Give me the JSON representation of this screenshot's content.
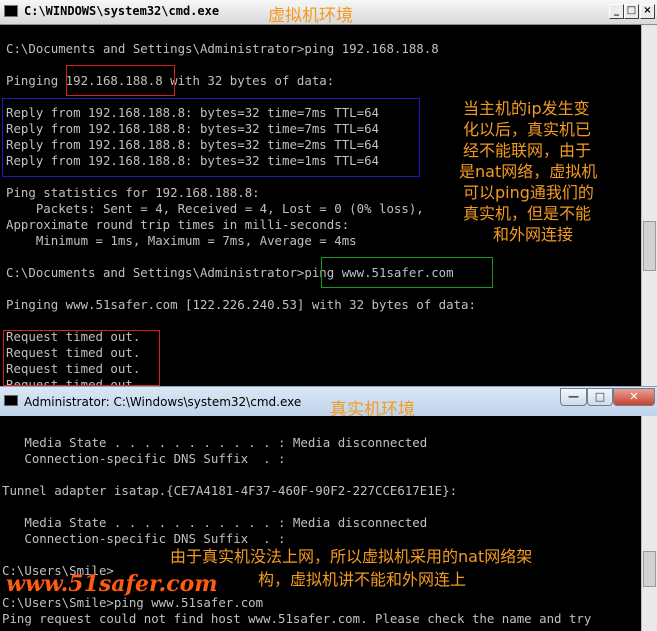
{
  "vm_window": {
    "title": "C:\\WINDOWS\\system32\\cmd.exe",
    "title_overlay": "虚拟机环境",
    "controls": {
      "minimize": "_",
      "maximize": "□",
      "close": "×"
    },
    "lines": [
      "C:\\Documents and Settings\\Administrator>ping 192.168.188.8",
      "",
      "Pinging 192.168.188.8 with 32 bytes of data:",
      "",
      "Reply from 192.168.188.8: bytes=32 time=7ms TTL=64",
      "Reply from 192.168.188.8: bytes=32 time=7ms TTL=64",
      "Reply from 192.168.188.8: bytes=32 time=2ms TTL=64",
      "Reply from 192.168.188.8: bytes=32 time=1ms TTL=64",
      "",
      "Ping statistics for 192.168.188.8:",
      "    Packets: Sent = 4, Received = 4, Lost = 0 (0% loss),",
      "Approximate round trip times in milli-seconds:",
      "    Minimum = 1ms, Maximum = 7ms, Average = 4ms",
      "",
      "C:\\Documents and Settings\\Administrator>ping www.51safer.com",
      "",
      "Pinging www.51safer.com [122.226.240.53] with 32 bytes of data:",
      "",
      "Request timed out.",
      "Request timed out.",
      "Request timed out.",
      "Request timed out."
    ],
    "annotation": [
      "当主机的ip发生变",
      "化以后，真实机已",
      "经不能联网，由于",
      "是nat网络，虚拟机",
      "可以ping通我们的",
      "真实机，但是不能",
      "和外网连接"
    ]
  },
  "host_window": {
    "title": "Administrator: C:\\Windows\\system32\\cmd.exe",
    "title_overlay": "真实机环境",
    "controls": {
      "minimize": "—",
      "maximize": "□",
      "close": "✕"
    },
    "lines": [
      "",
      "   Media State . . . . . . . . . . . : Media disconnected",
      "   Connection-specific DNS Suffix  . :",
      "",
      "Tunnel adapter isatap.{CE7A4181-4F37-460F-90F2-227CCE617E1E}:",
      "",
      "   Media State . . . . . . . . . . . : Media disconnected",
      "   Connection-specific DNS Suffix  . :",
      "",
      "C:\\Users\\Smile>",
      "",
      "C:\\Users\\Smile>ping www.51safer.com",
      "Ping request could not find host www.51safer.com. Please check the name and try"
    ],
    "annotation": [
      "由于真实机没法上网，所以虚拟机采用的nat网络架",
      "构，虚拟机讲不能和外网连上"
    ]
  },
  "watermark": "www.51safer.com",
  "colors": {
    "annotation": "#f39a22",
    "watermark": "#ff5b12",
    "box_red": "#d42020",
    "box_blue": "#1a1ab8",
    "box_green": "#1a9a1a",
    "console_text": "#c0c0c0"
  }
}
